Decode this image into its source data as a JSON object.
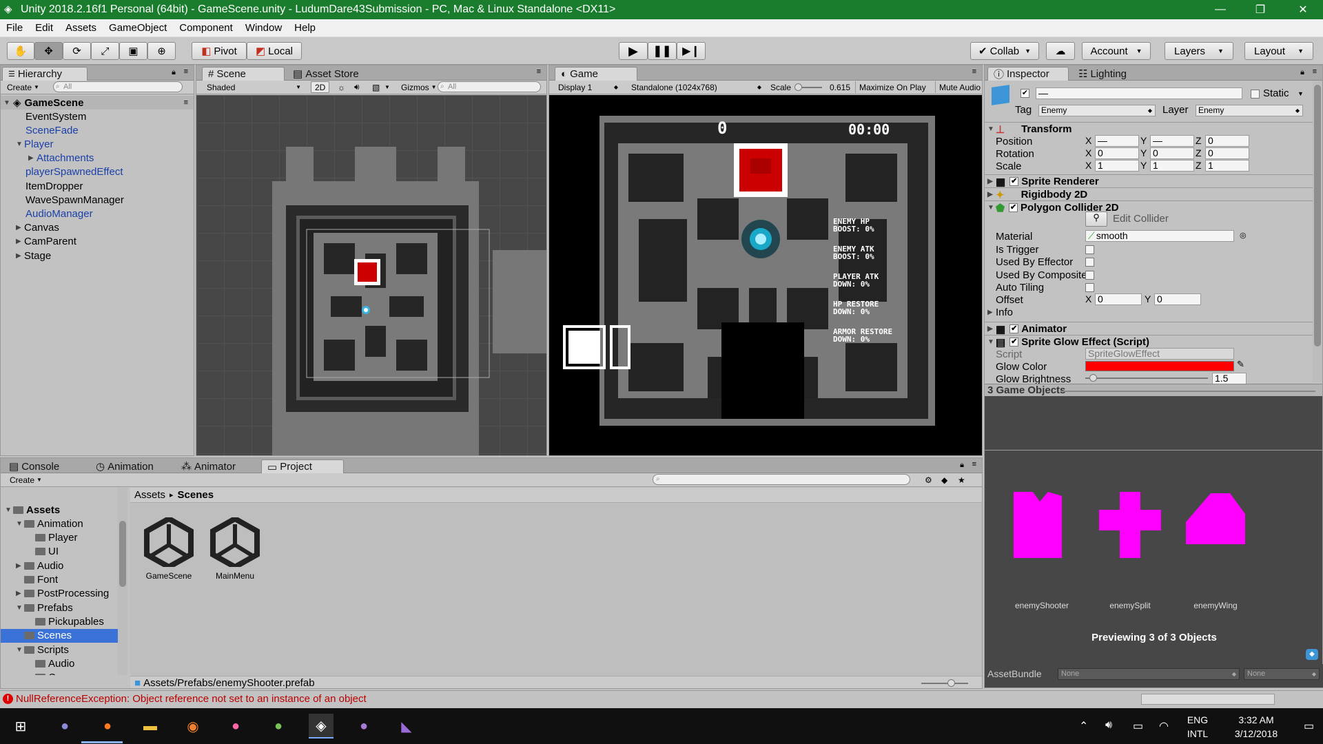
{
  "window": {
    "title": "Unity 2018.2.16f1 Personal (64bit) - GameScene.unity - LudumDare43Submission - PC, Mac & Linux Standalone <DX11>",
    "minimize": "—",
    "maximize": "❐",
    "close": "✕"
  },
  "menu": [
    "File",
    "Edit",
    "Assets",
    "GameObject",
    "Component",
    "Window",
    "Help"
  ],
  "toolbar": {
    "pivot": "Pivot",
    "local": "Local",
    "collab": "Collab",
    "account": "Account",
    "layers": "Layers",
    "layout": "Layout"
  },
  "hierarchy": {
    "tab": "Hierarchy",
    "create": "Create",
    "search_placeholder": "All",
    "scene": "GameScene",
    "items": [
      {
        "label": "EventSystem",
        "prefab": false,
        "arrow": false
      },
      {
        "label": "SceneFade",
        "prefab": true,
        "arrow": false
      },
      {
        "label": "Player",
        "prefab": true,
        "arrow": "open"
      },
      {
        "label": "Attachments",
        "prefab": true,
        "arrow": "closed"
      },
      {
        "label": "playerSpawnedEffect",
        "prefab": true,
        "arrow": false
      },
      {
        "label": "ItemDropper",
        "prefab": false,
        "arrow": false
      },
      {
        "label": "WaveSpawnManager",
        "prefab": false,
        "arrow": false
      },
      {
        "label": "AudioManager",
        "prefab": true,
        "arrow": false
      },
      {
        "label": "Canvas",
        "prefab": false,
        "arrow": "closed"
      },
      {
        "label": "CamParent",
        "prefab": false,
        "arrow": "closed"
      },
      {
        "label": "Stage",
        "prefab": false,
        "arrow": "closed"
      }
    ]
  },
  "scene": {
    "tab": "Scene",
    "asset_store_tab": "Asset Store",
    "shading": "Shaded",
    "mode2d": "2D",
    "gizmos": "Gizmos",
    "search_placeholder": "All"
  },
  "game": {
    "tab": "Game",
    "display": "Display 1",
    "resolution": "Standalone (1024x768)",
    "scale_label": "Scale",
    "scale_value": "0.615",
    "maximize": "Maximize On Play",
    "mute": "Mute Audio",
    "score": "0",
    "timer": "00:00",
    "stats": [
      "ENEMY HP\nBOOST: 0%",
      "ENEMY ATK\nBOOST: 0%",
      "PLAYER ATK\nDOWN: 0%",
      "HP RESTORE\nDOWN: 0%",
      "ARMOR RESTORE\nDOWN: 0%"
    ]
  },
  "inspector": {
    "tab": "Inspector",
    "lighting_tab": "Lighting",
    "name_value": "—",
    "static_label": "Static",
    "tag_label": "Tag",
    "tag_value": "Enemy",
    "layer_label": "Layer",
    "layer_value": "Enemy",
    "transform": {
      "title": "Transform",
      "position_label": "Position",
      "rotation_label": "Rotation",
      "scale_label": "Scale",
      "position": [
        "—",
        "—",
        "0"
      ],
      "rotation": [
        "0",
        "0",
        "0"
      ],
      "scale": [
        "1",
        "1",
        "1"
      ]
    },
    "sprite_renderer": "Sprite Renderer",
    "rigidbody": "Rigidbody 2D",
    "collider": {
      "title": "Polygon Collider 2D",
      "edit": "Edit Collider",
      "material_label": "Material",
      "material_value": "smooth",
      "is_trigger": "Is Trigger",
      "used_by_effector": "Used By Effector",
      "used_by_composite": "Used By Composite",
      "auto_tiling": "Auto Tiling",
      "offset_label": "Offset",
      "offset": [
        "0",
        "0"
      ],
      "info": "Info"
    },
    "animator": "Animator",
    "glow": {
      "title": "Sprite Glow Effect (Script)",
      "script_label": "Script",
      "script_value": "SpriteGlowEffect",
      "color_label": "Glow Color",
      "color": "#ff0000",
      "brightness_label": "Glow Brightness",
      "brightness_value": "1.5"
    },
    "axis": {
      "x": "X",
      "y": "Y",
      "z": "Z"
    }
  },
  "preview": {
    "header": "3 Game Objects",
    "items": [
      "enemyShooter",
      "enemySplit",
      "enemyWing"
    ],
    "caption": "Previewing 3 of 3 Objects",
    "assetbundle_label": "AssetBundle",
    "assetbundle_value": "None",
    "variant_value": "None",
    "shape_color": "#ff00ff"
  },
  "bottom": {
    "tabs": [
      "Console",
      "Animation",
      "Animator",
      "Project"
    ],
    "create": "Create",
    "breadcrumb_root": "Assets",
    "breadcrumb_sep": "▸",
    "breadcrumb_current": "Scenes",
    "assets": [
      "GameScene",
      "MainMenu"
    ],
    "path": "Assets/Prefabs/enemyShooter.prefab",
    "folders": [
      {
        "label": "Assets",
        "indent": 0,
        "arrow": "open",
        "bold": true
      },
      {
        "label": "Animation",
        "indent": 1,
        "arrow": "open"
      },
      {
        "label": "Player",
        "indent": 2,
        "arrow": false
      },
      {
        "label": "UI",
        "indent": 2,
        "arrow": false
      },
      {
        "label": "Audio",
        "indent": 1,
        "arrow": "closed"
      },
      {
        "label": "Font",
        "indent": 1,
        "arrow": false
      },
      {
        "label": "PostProcessing",
        "indent": 1,
        "arrow": "closed"
      },
      {
        "label": "Prefabs",
        "indent": 1,
        "arrow": "open"
      },
      {
        "label": "Pickupables",
        "indent": 2,
        "arrow": false
      },
      {
        "label": "Scenes",
        "indent": 1,
        "arrow": false,
        "selected": true
      },
      {
        "label": "Scripts",
        "indent": 1,
        "arrow": "open"
      },
      {
        "label": "Audio",
        "indent": 2,
        "arrow": false
      },
      {
        "label": "Camera",
        "indent": 2,
        "arrow": false
      }
    ]
  },
  "status": {
    "error": "NullReferenceException: Object reference not set to an instance of an object"
  },
  "taskbar": {
    "lang1": "ENG",
    "lang2": "INTL",
    "time": "3:32 AM",
    "date": "3/12/2018"
  }
}
